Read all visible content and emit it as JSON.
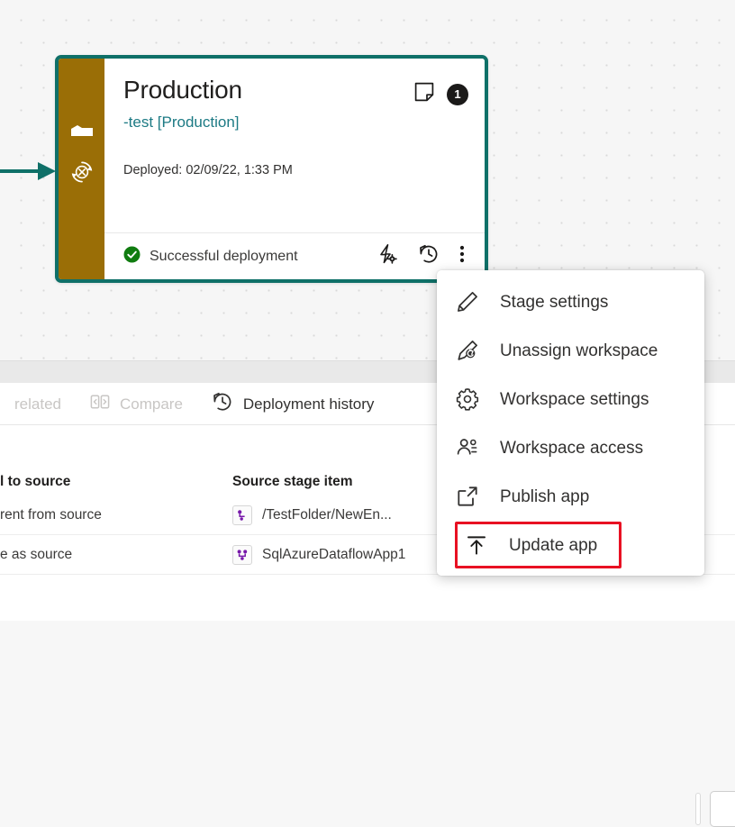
{
  "canvas": {
    "arrow": "incoming-arrow"
  },
  "stage_card": {
    "title": "Production",
    "subtitle": "-test [Production]",
    "deployed_label": "Deployed: 02/09/22, 1:33 PM",
    "badge_count": "1",
    "status_text": "Successful deployment",
    "accent_border_color": "#0f7068",
    "rail_color": "#9a6e06",
    "subtitle_color": "#1c7a84",
    "status_color": "#107c10",
    "rail_icons": [
      "stage-layers-icon",
      "refresh-failed-icon"
    ],
    "title_icons": [
      "sticky-note-icon"
    ],
    "footer_icons": [
      "deployment-settings-icon",
      "deployment-history-icon",
      "more-options-icon"
    ]
  },
  "tabs": [
    {
      "label": "related",
      "icon": "",
      "state": "disabled"
    },
    {
      "label": "Compare",
      "icon": "compare-icon",
      "state": "disabled"
    },
    {
      "label": "Deployment history",
      "icon": "history-icon",
      "state": "enabled"
    }
  ],
  "table": {
    "headers": {
      "col_a": "l to source",
      "col_b": "Source stage item"
    },
    "rows": [
      {
        "col_a": "rent from source",
        "col_b": "/TestFolder/NewEn...",
        "icon": "dataflow-item-icon"
      },
      {
        "col_a": "e as source",
        "col_b": "SqlAzureDataflowApp1",
        "icon": "dataflow-item-icon"
      }
    ]
  },
  "context_menu": {
    "highlight_color": "#e81123",
    "items": [
      {
        "label": "Stage settings",
        "icon": "pencil-icon",
        "highlighted": false
      },
      {
        "label": "Unassign workspace",
        "icon": "unassign-workspace-icon",
        "highlighted": false
      },
      {
        "label": "Workspace settings",
        "icon": "gear-icon",
        "highlighted": false
      },
      {
        "label": "Workspace access",
        "icon": "people-icon",
        "highlighted": false
      },
      {
        "label": "Publish app",
        "icon": "external-link-icon",
        "highlighted": false
      },
      {
        "label": "Update app",
        "icon": "upload-arrow-icon",
        "highlighted": true
      }
    ]
  }
}
